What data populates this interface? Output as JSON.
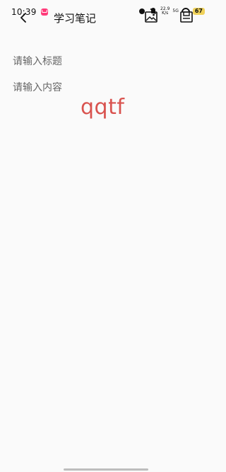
{
  "status_bar": {
    "time": "10:39",
    "speed_value": "22.9",
    "speed_unit": "K/s",
    "network": "5G",
    "battery": "67"
  },
  "app_bar": {
    "title": "学习笔记"
  },
  "form": {
    "title_placeholder": "请输入标题",
    "title_value": "",
    "content_placeholder": "请输入内容",
    "content_value": ""
  },
  "overlay_text": "qqtf",
  "colors": {
    "background": "#fafafa",
    "overlay_text": "#d9534f",
    "app_notification": "#ff3b7a",
    "battery": "#f0d25a"
  },
  "icons": {
    "back": "chevron-left-icon",
    "image": "image-icon",
    "save": "save-icon",
    "alarm": "alarm-icon",
    "mute": "mute-icon",
    "wifi": "wifi-icon",
    "app_notification": "app-notification-icon"
  }
}
